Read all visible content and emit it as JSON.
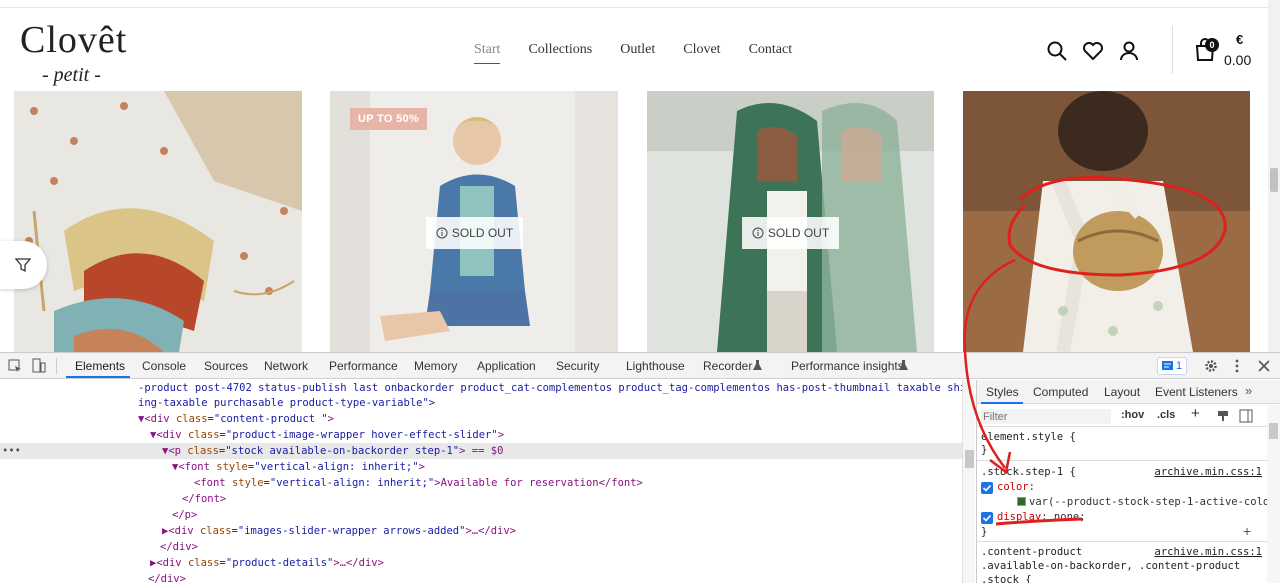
{
  "header": {
    "logo_main": "Clovêt",
    "logo_sub": "- petit -",
    "nav": [
      "Start",
      "Collections",
      "Outlet",
      "Clovet",
      "Contact"
    ],
    "cart_count": "0",
    "currency": "€",
    "amount": "0.00"
  },
  "products": {
    "badge": "UP TO 50%",
    "sold_out": "SOLD OUT"
  },
  "devtools": {
    "tabs": [
      "Elements",
      "Console",
      "Sources",
      "Network",
      "Performance",
      "Memory",
      "Application",
      "Security",
      "Lighthouse",
      "Recorder",
      "Performance insights"
    ],
    "issues_count": "1",
    "dom_lines": [
      {
        "text": "-product post-4702 status-publish last onbackorder product_cat-complementos product_tag-complementos has-post-thumbnail taxable shipp"
      },
      {
        "text": "ing-taxable purchasable product-type-variable\">"
      },
      {
        "tag_open": "▼<div ",
        "attr": "class",
        "val": "\"content-product \"",
        "tail": ">"
      },
      {
        "tag_open": "▼<div ",
        "attr": "class",
        "val": "\"product-image-wrapper hover-effect-slider\"",
        "tail": ">"
      },
      {
        "tag_open": "▼<p ",
        "attr": "class",
        "val": "\"stock available-on-backorder step-1\"",
        "tail": "> == $0"
      },
      {
        "tag_open": "▼<font ",
        "attr": "style",
        "val": "\"vertical-align: inherit;\"",
        "tail": ">"
      },
      {
        "tag_open": "<font ",
        "attr": "style",
        "val": "\"vertical-align: inherit;\"",
        "tail": ">Available for reservation</font>"
      },
      {
        "text": "</font>"
      },
      {
        "text": "</p>"
      },
      {
        "tag_open": "▶<div ",
        "attr": "class",
        "val": "\"images-slider-wrapper arrows-added\"",
        "tail": ">…</div>"
      },
      {
        "text": "</div>"
      },
      {
        "tag_open": "▶<div ",
        "attr": "class",
        "val": "\"product-details\"",
        "tail": ">…</div>"
      },
      {
        "text": "</div>"
      }
    ],
    "styles": {
      "tabs": [
        "Styles",
        "Computed",
        "Layout",
        "Event Listeners"
      ],
      "filter_placeholder": "Filter",
      "hov": ":hov",
      "cls": ".cls",
      "element_style": "element.style {",
      "close_brace": "}",
      "rule1_selector": ".stock.step-1 {",
      "rule1_source": "archive.min.css:1",
      "rule1_prop1": "color",
      "rule1_val1": "var(--product-stock-step-1-active-colo",
      "rule1_prop2": "display",
      "rule1_val2": "none;",
      "rule2_sel1": ".content-product",
      "rule2_sel2": ".available-on-backorder, .content-product",
      "rule2_sel3": ".stock {",
      "rule2_source": "archive.min.css:1"
    }
  },
  "colors": {
    "accent": "#1a73e8",
    "badge": "#e7b5a8",
    "annotation": "#e0201c"
  }
}
